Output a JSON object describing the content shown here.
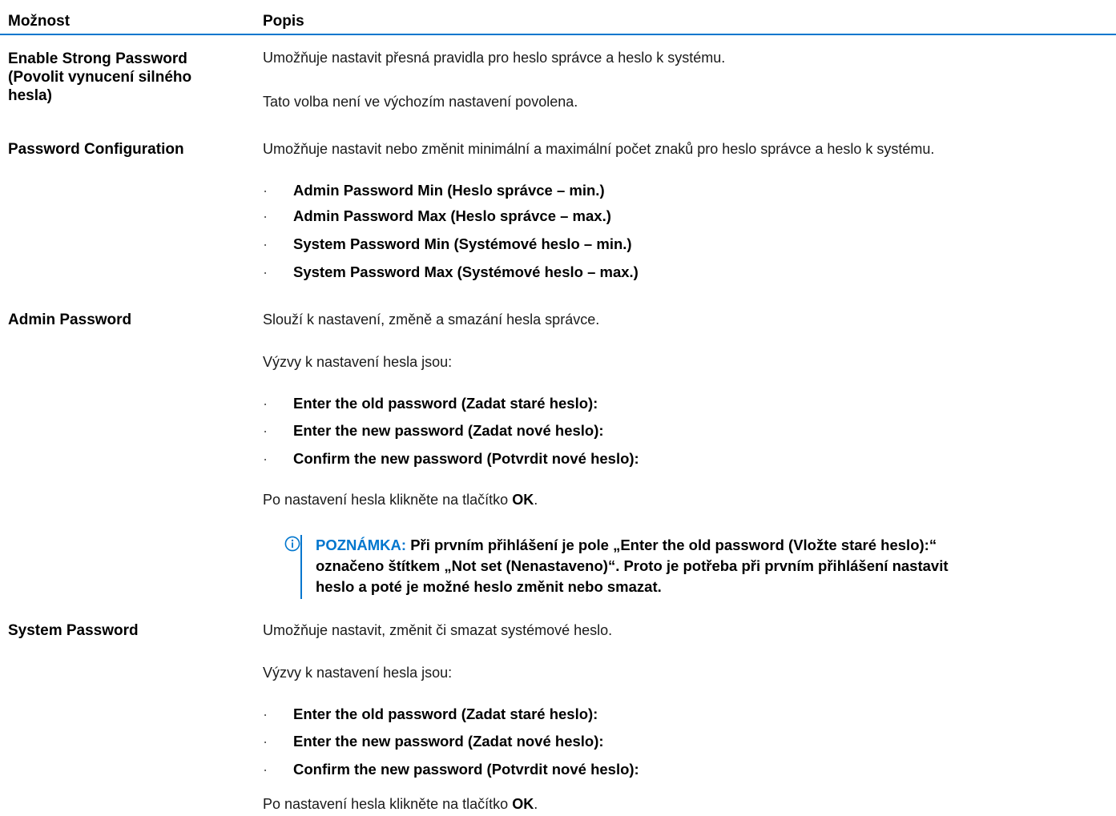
{
  "header": {
    "col_option": "Možnost",
    "col_description": "Popis"
  },
  "rows": {
    "strong_password": {
      "option_line1": "Enable Strong Password",
      "option_line2": "(Povolit vynucení silného",
      "option_line3": "hesla)",
      "desc1": "Umožňuje nastavit přesná pravidla pro heslo správce a heslo k systému.",
      "desc2": "Tato volba není ve výchozím nastavení povolena."
    },
    "password_config": {
      "option": "Password Configuration",
      "desc": "Umožňuje nastavit nebo změnit minimální a maximální počet znaků pro heslo správce a heslo k systému.",
      "bullets": [
        "Admin Password Min (Heslo správce – min.)",
        "Admin Password Max (Heslo správce – max.)",
        "System Password Min (Systémové heslo – min.)",
        "System Password Max (Systémové heslo – max.)"
      ]
    },
    "admin_password": {
      "option": "Admin Password",
      "desc1": "Slouží k nastavení, změně a smazání hesla správce.",
      "desc2": "Výzvy k nastavení hesla jsou:",
      "bullets": [
        "Enter the old password (Zadat staré heslo):",
        "Enter the new password (Zadat nové heslo):",
        "Confirm the new password (Potvrdit nové heslo):"
      ],
      "after_prefix": "Po nastavení hesla klikněte na tlačítko",
      "after_bold": "OK",
      "after_suffix": ".",
      "note_label": "POZNÁMKA:",
      "note_line1": "Při prvním přihlášení je pole „Enter the old password (Vložte staré heslo):“",
      "note_line2": "označeno štítkem „Not set (Nenastaveno)“. Proto je potřeba při prvním přihlášení nastavit",
      "note_line3": "heslo a poté je možné heslo změnit nebo smazat."
    },
    "system_password": {
      "option": "System Password",
      "desc1": "Umožňuje nastavit, změnit či smazat systémové heslo.",
      "desc2": "Výzvy k nastavení hesla jsou:",
      "bullets": [
        "Enter the old password (Zadat staré heslo):",
        "Enter the new password (Zadat nové heslo):",
        "Confirm the new password (Potvrdit nové heslo):"
      ],
      "after_prefix": "Po nastavení hesla klikněte na tlačítko",
      "after_bold": "OK",
      "after_suffix": "."
    }
  },
  "bullet_symbol": "·",
  "icons": {
    "note": "info-icon"
  },
  "colors": {
    "accent": "#0076ce"
  }
}
